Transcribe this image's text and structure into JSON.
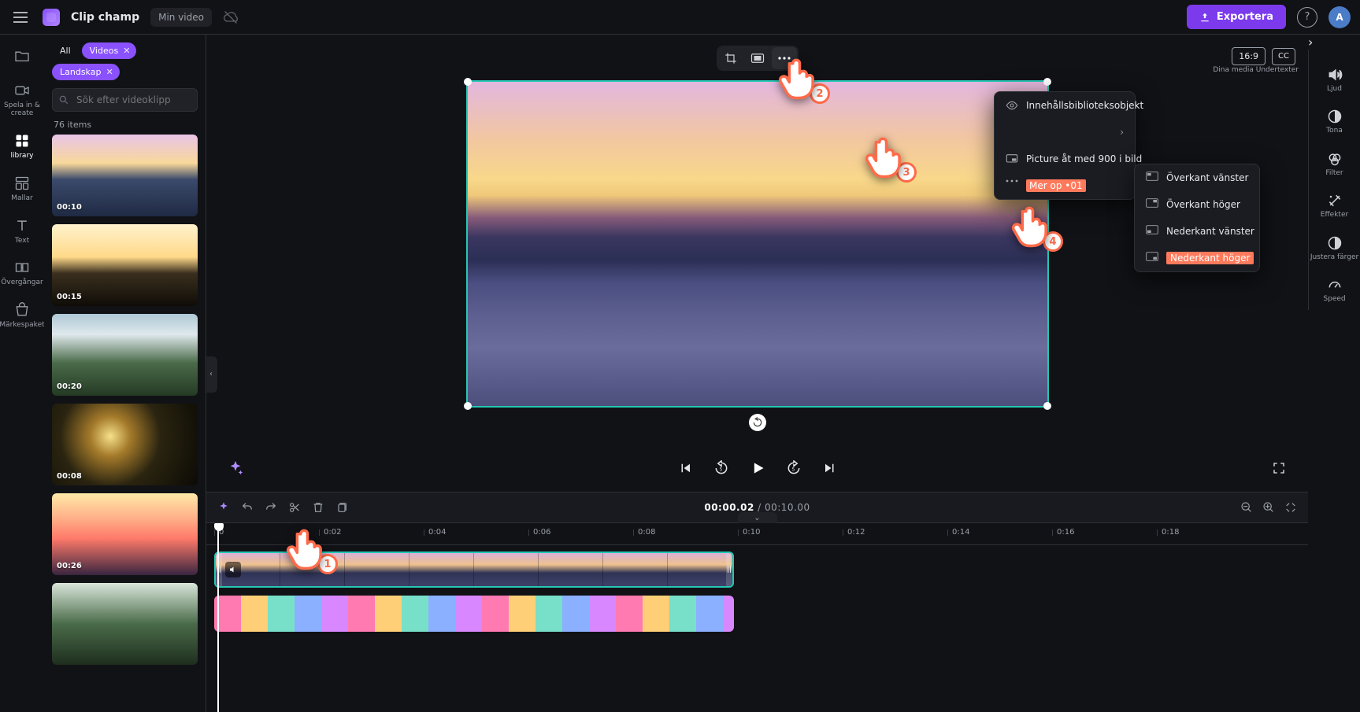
{
  "app": {
    "name": "Clip champ",
    "project": "Min video"
  },
  "topbar": {
    "export": "Exportera",
    "avatar_initial": "A"
  },
  "rail": [
    {
      "id": "media-icon",
      "label": ""
    },
    {
      "id": "record-icon",
      "label": "Spela in & create"
    },
    {
      "id": "library-icon",
      "label": "library"
    },
    {
      "id": "templates-icon",
      "label": "Mallar"
    },
    {
      "id": "text-icon",
      "label": "Text"
    },
    {
      "id": "transitions-icon",
      "label": "Övergångar"
    },
    {
      "id": "brandkit-icon",
      "label": "Märkespaket"
    }
  ],
  "library": {
    "chips": [
      {
        "label": "All",
        "style": "plain"
      },
      {
        "label": "Videos",
        "style": "purple",
        "closable": true
      },
      {
        "label": "Landskap",
        "style": "purple",
        "closable": true
      }
    ],
    "search_placeholder": "Sök efter videoklipp",
    "count": "76",
    "count_suffix": "items",
    "thumbs": [
      {
        "duration": "00:10",
        "cls": "t1"
      },
      {
        "duration": "00:15",
        "cls": "t2"
      },
      {
        "duration": "00:20",
        "cls": "t3"
      },
      {
        "duration": "00:08",
        "cls": "t4"
      },
      {
        "duration": "00:26",
        "cls": "t5"
      },
      {
        "duration": "",
        "cls": "t6"
      }
    ]
  },
  "stage": {
    "ratio": "16:9",
    "right_hint": "Dina media Undertexter",
    "cc": "CC"
  },
  "context_menu_1": [
    {
      "label": "Innehållsbiblioteksobjekt",
      "icon": "eye-icon"
    },
    {
      "label": "",
      "icon": "",
      "submenu": true
    },
    {
      "label": "Picture åt med 900 i bild",
      "icon": "pip-icon"
    },
    {
      "label": "Mer op •01",
      "icon": "more-icon",
      "highlight": true
    }
  ],
  "context_menu_2": [
    {
      "label": "Överkant vänster"
    },
    {
      "label": "Överkant höger"
    },
    {
      "label": "Nederkant vänster"
    },
    {
      "label": "Nederkant höger",
      "selected": true
    }
  ],
  "timecode": {
    "elapsed": "00:00.02",
    "total": "00:10.00",
    "sep": " / "
  },
  "ruler": [
    {
      "pos": 10,
      "label": "0"
    },
    {
      "pos": 143,
      "label": "0:02"
    },
    {
      "pos": 276,
      "label": "0:04"
    },
    {
      "pos": 409,
      "label": "0:06"
    },
    {
      "pos": 542,
      "label": "0:08"
    },
    {
      "pos": 675,
      "label": "0:10"
    },
    {
      "pos": 808,
      "label": "0:12"
    },
    {
      "pos": 941,
      "label": "0:14"
    },
    {
      "pos": 1074,
      "label": "0:16"
    },
    {
      "pos": 1207,
      "label": "0:18"
    }
  ],
  "right_rail": [
    {
      "id": "audio-icon",
      "label": "Ljud"
    },
    {
      "id": "fade-icon",
      "label": "Tona"
    },
    {
      "id": "filter-icon",
      "label": "Filter"
    },
    {
      "id": "effects-icon",
      "label": "Effekter"
    },
    {
      "id": "adjust-icon",
      "label": "Justera färger"
    },
    {
      "id": "speed-icon",
      "label": "Speed"
    }
  ],
  "pointers": {
    "1": "1",
    "2": "2",
    "3": "3",
    "4": "4"
  }
}
